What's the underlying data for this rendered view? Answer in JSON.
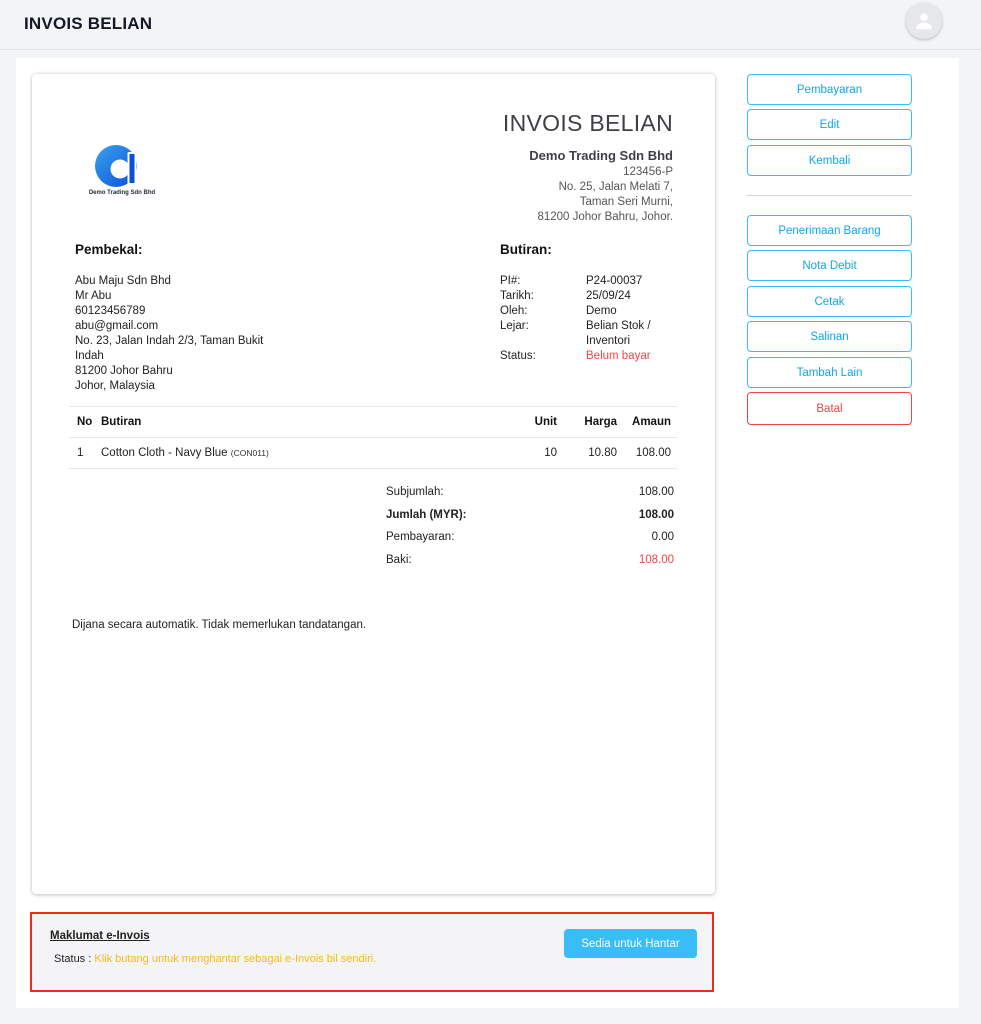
{
  "header": {
    "title": "INVOIS BELIAN"
  },
  "invoice": {
    "title": "INVOIS BELIAN",
    "logo_caption": "Demo Trading Sdn Bhd",
    "company": {
      "name": "Demo Trading Sdn Bhd",
      "reg_no": "123456-P",
      "address1": "No. 25, Jalan Melati 7,",
      "address2": "Taman Seri Murni,",
      "address3": "81200 Johor Bahru, Johor."
    },
    "supplier": {
      "heading": "Pembekal:",
      "name": "Abu Maju Sdn Bhd",
      "contact": "Mr Abu",
      "phone": "60123456789",
      "email": "abu@gmail.com",
      "address1": "No. 23, Jalan Indah 2/3, Taman Bukit Indah",
      "address2": "81200 Johor Bahru",
      "address3": "Johor, Malaysia"
    },
    "details": {
      "heading": "Butiran:",
      "pi_label": "PI#:",
      "pi_value": "P24-00037",
      "date_label": "Tarikh:",
      "date_value": "25/09/24",
      "by_label": "Oleh:",
      "by_value": "Demo",
      "ledger_label": "Lejar:",
      "ledger_value": "Belian Stok / Inventori",
      "status_label": "Status:",
      "status_value": "Belum bayar"
    },
    "table": {
      "headers": {
        "no": "No",
        "item": "Butiran",
        "unit": "Unit",
        "price": "Harga",
        "amount": "Amaun"
      },
      "rows": [
        {
          "no": "1",
          "item": "Cotton Cloth - Navy Blue",
          "code": "(CON011)",
          "unit": "10",
          "price": "10.80",
          "amount": "108.00"
        }
      ]
    },
    "totals": {
      "subtotal_label": "Subjumlah:",
      "subtotal_value": "108.00",
      "total_label": "Jumlah (MYR):",
      "total_value": "108.00",
      "paid_label": "Pembayaran:",
      "paid_value": "0.00",
      "balance_label": "Baki:",
      "balance_value": "108.00"
    },
    "footnote": "Dijana secara automatik. Tidak memerlukan tandatangan."
  },
  "actions": {
    "payment": "Pembayaran",
    "edit": "Edit",
    "back": "Kembali",
    "goods_receipt": "Penerimaan Barang",
    "debit_note": "Nota Debit",
    "print": "Cetak",
    "copy": "Salinan",
    "more": "Tambah Lain",
    "cancel": "Batal"
  },
  "einvoice": {
    "title": "Maklumat e-Invois",
    "status_label": "Status :",
    "status_hint": "Klik butang untuk menghantar sebagai e-Invois bil sendiri.",
    "send_button": "Sedia untuk Hantar"
  },
  "colors": {
    "accent": "#38bdf8",
    "danger": "#ef4444",
    "warning": "#f5b91e",
    "highlight_border": "#ef2a16"
  }
}
